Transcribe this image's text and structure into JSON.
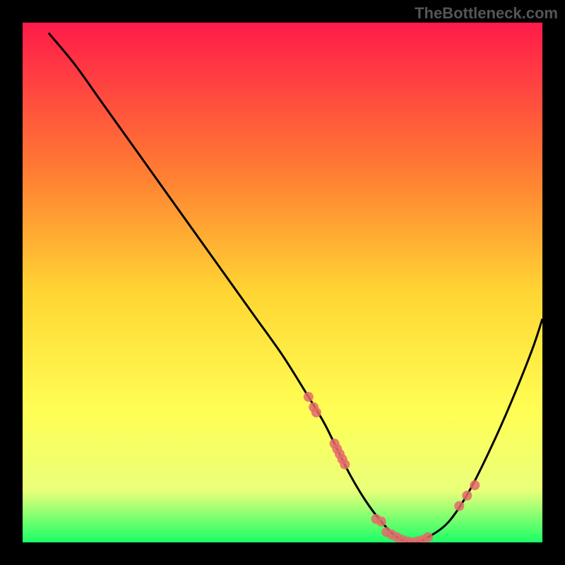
{
  "watermark": "TheBottleneck.com",
  "chart_data": {
    "type": "line",
    "title": "",
    "xlabel": "",
    "ylabel": "",
    "xlim": [
      0,
      100
    ],
    "ylim": [
      0,
      100
    ],
    "background_gradient": {
      "top": "#ff1a4a",
      "mid_upper": "#ff7a33",
      "mid": "#ffd633",
      "mid_lower": "#ffff55",
      "low": "#eaff7a",
      "bottom": "#1aff66"
    },
    "series": [
      {
        "name": "bottleneck-curve",
        "color": "#000000",
        "x": [
          5,
          10,
          15,
          20,
          25,
          30,
          35,
          40,
          45,
          50,
          55,
          58,
          60,
          63,
          66,
          69,
          72,
          75,
          78,
          82,
          86,
          90,
          94,
          98,
          100
        ],
        "y": [
          98,
          92,
          85,
          78,
          71,
          64,
          57,
          50,
          43,
          36,
          28,
          23,
          19,
          13,
          8,
          4,
          1,
          0,
          1,
          4,
          10,
          18,
          27,
          37,
          43
        ]
      }
    ],
    "scatter": [
      {
        "name": "curve-markers-left",
        "color": "#e46a6a",
        "points": [
          {
            "x": 55,
            "y": 28
          },
          {
            "x": 56,
            "y": 26
          },
          {
            "x": 56.5,
            "y": 25
          },
          {
            "x": 60,
            "y": 19
          },
          {
            "x": 60.5,
            "y": 18
          },
          {
            "x": 61,
            "y": 17
          },
          {
            "x": 61.5,
            "y": 16
          },
          {
            "x": 62,
            "y": 15
          }
        ]
      },
      {
        "name": "curve-markers-bottom",
        "color": "#e46a6a",
        "points": [
          {
            "x": 68,
            "y": 4.5
          },
          {
            "x": 69,
            "y": 4
          },
          {
            "x": 70,
            "y": 2
          },
          {
            "x": 71,
            "y": 1.5
          },
          {
            "x": 72,
            "y": 1
          },
          {
            "x": 73,
            "y": 0.5
          },
          {
            "x": 74,
            "y": 0.2
          },
          {
            "x": 75,
            "y": 0
          },
          {
            "x": 76,
            "y": 0.2
          },
          {
            "x": 77,
            "y": 0.5
          },
          {
            "x": 78,
            "y": 1
          }
        ]
      },
      {
        "name": "curve-markers-right",
        "color": "#e46a6a",
        "points": [
          {
            "x": 84,
            "y": 7
          },
          {
            "x": 85.5,
            "y": 9
          },
          {
            "x": 87,
            "y": 11
          }
        ]
      }
    ]
  }
}
